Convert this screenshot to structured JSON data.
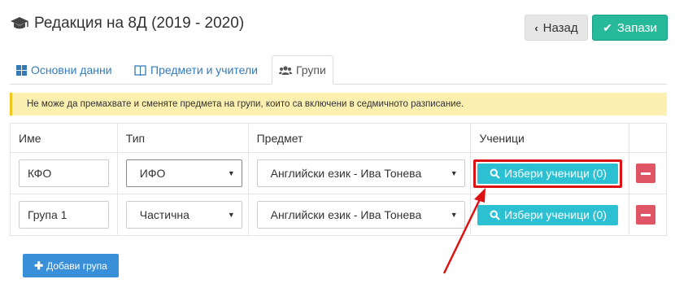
{
  "header": {
    "title": "Редакция на 8Д (2019 - 2020)",
    "icon": "graduation-cap-icon"
  },
  "actions": {
    "back_label": "Назад",
    "save_label": "Запази"
  },
  "tabs": [
    {
      "label": "Основни данни",
      "icon": "grid-icon",
      "active": false
    },
    {
      "label": "Предмети и учители",
      "icon": "book-icon",
      "active": false
    },
    {
      "label": "Групи",
      "icon": "users-icon",
      "active": true
    }
  ],
  "alert": {
    "text": "Не може да премахвате и сменяте предмета на групи, които са включени в седмичното разписание."
  },
  "table": {
    "headers": [
      "Име",
      "Тип",
      "Предмет",
      "Ученици",
      ""
    ],
    "rows": [
      {
        "name": "КФО",
        "type": "ИФО",
        "subject": "Английски език - Ива Тонева",
        "pick_label": "Избери ученици (0)"
      },
      {
        "name": "Група 1",
        "type": "Частична",
        "subject": "Английски език - Ива Тонева",
        "pick_label": "Избери ученици (0)"
      }
    ]
  },
  "add_group_label": "Добави група",
  "colors": {
    "accent_teal": "#26b99a",
    "pick_cyan": "#2cc0d3",
    "danger": "#e05565",
    "primary": "#3a8fd9",
    "highlight_red": "#dd1111"
  }
}
